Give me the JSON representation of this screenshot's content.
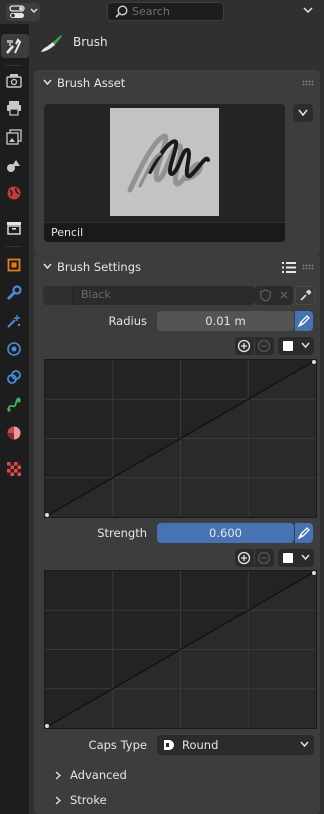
{
  "header": {
    "search_placeholder": "Search"
  },
  "context": {
    "title": "Brush"
  },
  "brush_asset": {
    "panel_title": "Brush Asset",
    "asset_name": "Pencil"
  },
  "brush_settings": {
    "panel_title": "Brush Settings",
    "color_name": "Black",
    "radius_label": "Radius",
    "radius_value": "0.01 m",
    "strength_label": "Strength",
    "strength_value": "0.600",
    "caps_type_label": "Caps Type",
    "caps_type_value": "Round",
    "subpanels": [
      "Advanced",
      "Stroke"
    ]
  },
  "tabs": [
    "tool-icon",
    "render-icon",
    "output-icon",
    "view-layer-icon",
    "scene-icon",
    "world-icon",
    "collection-icon",
    "object-icon",
    "modifier-icon",
    "particles-icon",
    "physics-icon",
    "constraints-icon",
    "data-icon",
    "material-icon",
    "texture-icon"
  ],
  "colors": {
    "accent_blue": "#4772b3",
    "panel_bg": "#3d3d3d",
    "editor_bg": "#303030"
  }
}
